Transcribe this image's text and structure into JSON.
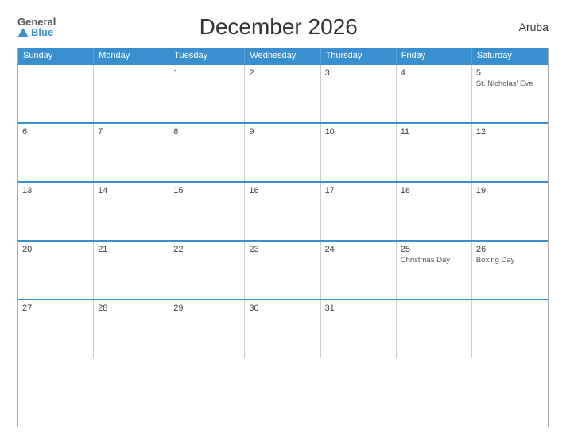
{
  "header": {
    "logo_general": "General",
    "logo_blue": "Blue",
    "title": "December 2026",
    "region": "Aruba"
  },
  "days_of_week": [
    "Sunday",
    "Monday",
    "Tuesday",
    "Wednesday",
    "Thursday",
    "Friday",
    "Saturday"
  ],
  "weeks": [
    [
      {
        "num": "",
        "event": ""
      },
      {
        "num": "",
        "event": ""
      },
      {
        "num": "1",
        "event": ""
      },
      {
        "num": "2",
        "event": ""
      },
      {
        "num": "3",
        "event": ""
      },
      {
        "num": "4",
        "event": ""
      },
      {
        "num": "5",
        "event": "St. Nicholas' Eve"
      }
    ],
    [
      {
        "num": "6",
        "event": ""
      },
      {
        "num": "7",
        "event": ""
      },
      {
        "num": "8",
        "event": ""
      },
      {
        "num": "9",
        "event": ""
      },
      {
        "num": "10",
        "event": ""
      },
      {
        "num": "11",
        "event": ""
      },
      {
        "num": "12",
        "event": ""
      }
    ],
    [
      {
        "num": "13",
        "event": ""
      },
      {
        "num": "14",
        "event": ""
      },
      {
        "num": "15",
        "event": ""
      },
      {
        "num": "16",
        "event": ""
      },
      {
        "num": "17",
        "event": ""
      },
      {
        "num": "18",
        "event": ""
      },
      {
        "num": "19",
        "event": ""
      }
    ],
    [
      {
        "num": "20",
        "event": ""
      },
      {
        "num": "21",
        "event": ""
      },
      {
        "num": "22",
        "event": ""
      },
      {
        "num": "23",
        "event": ""
      },
      {
        "num": "24",
        "event": ""
      },
      {
        "num": "25",
        "event": "Christmas Day"
      },
      {
        "num": "26",
        "event": "Boxing Day"
      }
    ],
    [
      {
        "num": "27",
        "event": ""
      },
      {
        "num": "28",
        "event": ""
      },
      {
        "num": "29",
        "event": ""
      },
      {
        "num": "30",
        "event": ""
      },
      {
        "num": "31",
        "event": ""
      },
      {
        "num": "",
        "event": ""
      },
      {
        "num": "",
        "event": ""
      }
    ]
  ]
}
